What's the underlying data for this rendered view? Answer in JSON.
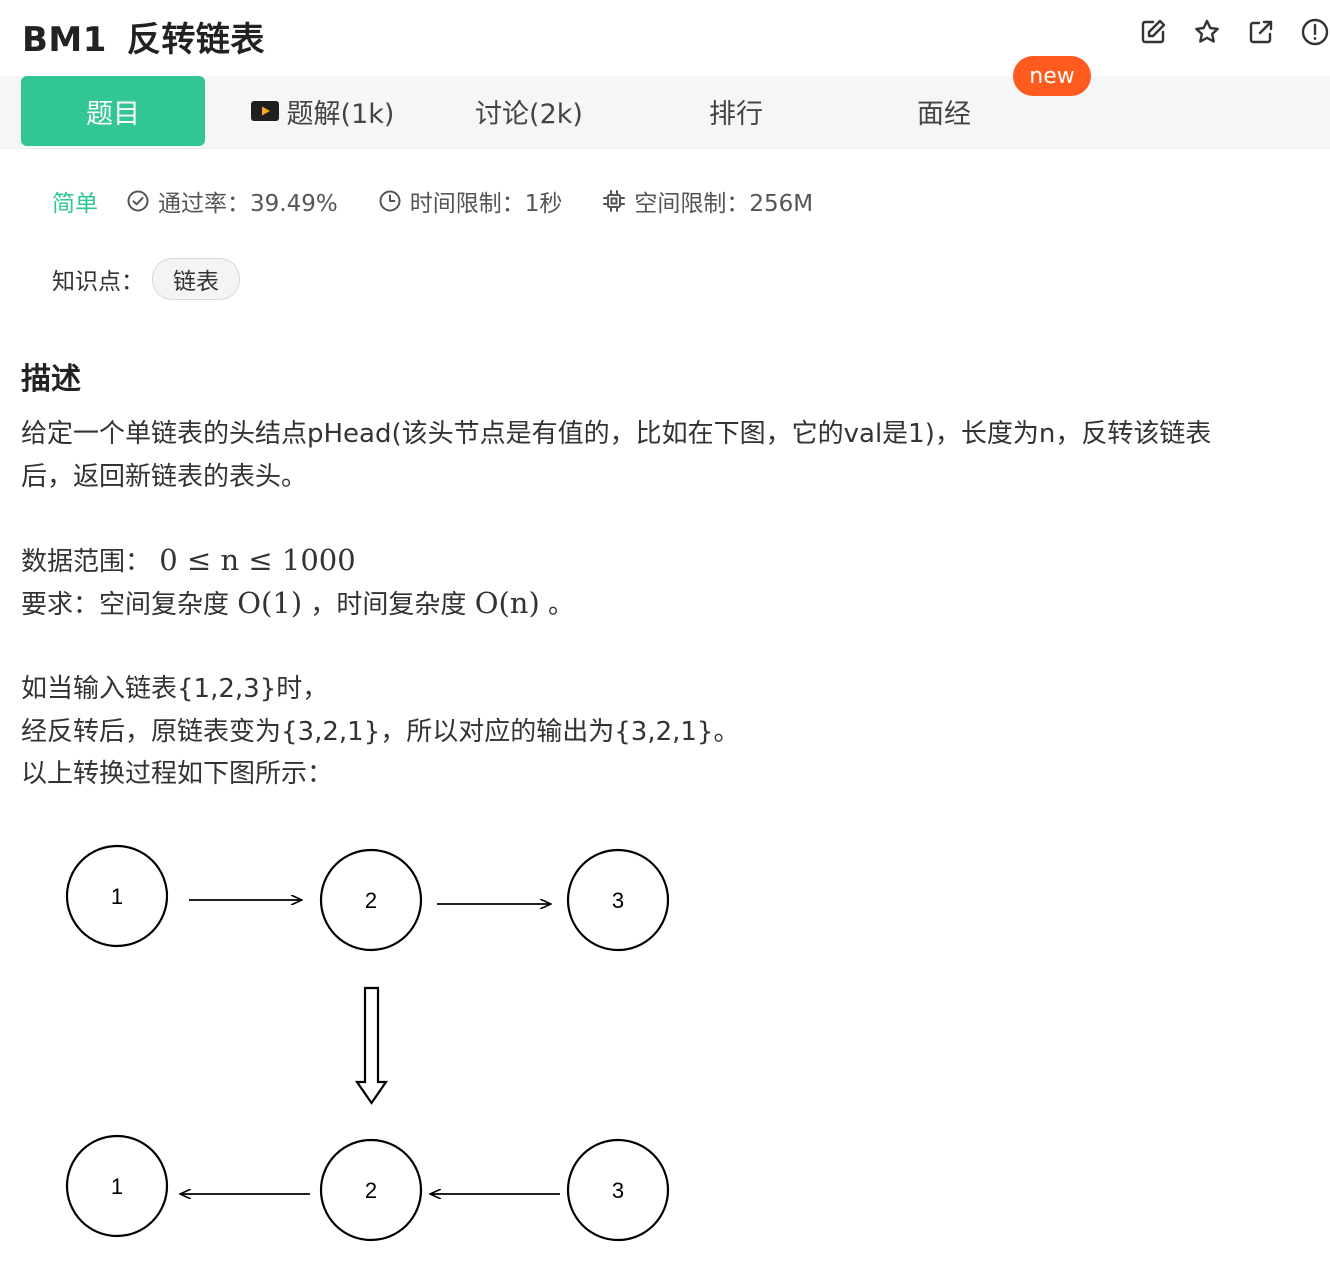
{
  "header": {
    "code": "BM1",
    "title": "反转链表"
  },
  "tabs": [
    {
      "label": "题目"
    },
    {
      "label": "题解(1k)"
    },
    {
      "label": "讨论(2k)"
    },
    {
      "label": "排行"
    },
    {
      "label": "面经"
    }
  ],
  "badge_new": "new",
  "meta": {
    "difficulty": "简单",
    "pass_rate": "通过率：39.49%",
    "time_limit": "时间限制：1秒",
    "space_limit": "空间限制：256M"
  },
  "knowledge": {
    "label": "知识点：",
    "tag": "链表"
  },
  "description": {
    "heading": "描述",
    "line1": "给定一个单链表的头结点pHead(该头节点是有值的，比如在下图，它的val是1)，长度为n，反转该链表",
    "line2": "后，返回新链表的表头。",
    "range_label": "数据范围：",
    "range_math": "0 ≤ n ≤ 1000",
    "req_label": "要求：空间复杂度",
    "req_space": "O(1)",
    "req_mid": "，时间复杂度",
    "req_time": "O(n)",
    "req_end": "。",
    "example1": "如当输入链表{1,2,3}时，",
    "example2": "经反转后，原链表变为{3,2,1}，所以对应的输出为{3,2,1}。",
    "example3": "以上转换过程如下图所示："
  },
  "diagram": {
    "top_nodes": [
      "1",
      "2",
      "3"
    ],
    "bottom_nodes": [
      "1",
      "2",
      "3"
    ]
  },
  "icons": [
    "edit-icon",
    "star-icon",
    "share-icon",
    "report-icon",
    "check-circle-icon",
    "clock-icon",
    "chip-icon",
    "video-icon",
    "down-arrow-icon"
  ],
  "colors": {
    "accent": "#32c693",
    "badge": "#ff5b1e"
  }
}
